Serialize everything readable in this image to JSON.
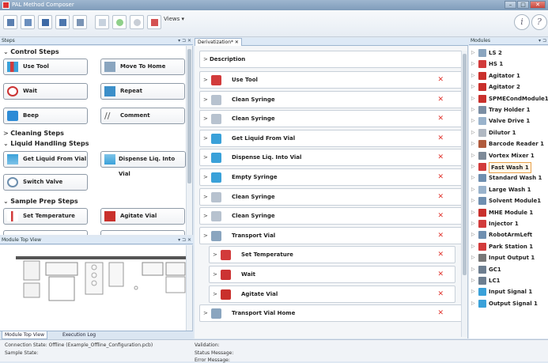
{
  "app": {
    "title": "PAL Method Composer"
  },
  "toolbar": {
    "views_label": "Views ▾",
    "help_label": "i",
    "help2_label": "?"
  },
  "steps_pane": {
    "title": "Steps",
    "sections": {
      "control": "Control Steps",
      "cleaning": "Cleaning Steps",
      "liquid": "Liquid Handling Steps",
      "sample_prep": "Sample Prep Steps"
    },
    "buttons": {
      "use_tool": "Use Tool",
      "move_home": "Move To Home",
      "wait": "Wait",
      "repeat": "Repeat",
      "beep": "Beep",
      "comment": "Comment",
      "get_liquid": "Get Liquid From Vial",
      "dispense": "Dispense Liq. Into Vial",
      "switch_valve": "Switch Valve",
      "set_temp": "Set Temperature",
      "agitate": "Agitate Vial"
    }
  },
  "module_view": {
    "title": "Module Top View"
  },
  "bottom_tabs": {
    "module_top_view": "Module Top View",
    "execution_log": "Execution Log"
  },
  "derivation": {
    "tab_label": "Derivatization* ✕",
    "description": "Description",
    "rows": [
      "Use Tool",
      "Clean Syringe",
      "Clean Syringe",
      "Get Liquid From Vial",
      "Dispense Liq. Into Vial",
      "Empty Syringe",
      "Clean Syringe",
      "Clean Syringe",
      "Transport Vial",
      "Set Temperature",
      "Wait",
      "Agitate Vial",
      "Transport Vial Home"
    ]
  },
  "modules_pane": {
    "title": "Modules",
    "items": [
      "LS 2",
      "HS 1",
      "Agitator 1",
      "Agitator 2",
      "SPMECondModule1",
      "Tray Holder 1",
      "Valve Drive 1",
      "Dilutor 1",
      "Barcode Reader 1",
      "Vortex Mixer 1",
      "Fast Wash 1",
      "Standard Wash 1",
      "Large Wash 1",
      "Solvent Module1",
      "MHE Module 1",
      "Injector 1",
      "RobotArmLeft",
      "Park Station 1",
      "Input Output 1",
      "GC1",
      "LC1",
      "Input Signal 1",
      "Output Signal 1"
    ]
  },
  "status": {
    "connection": "Connection State:   Offline (Example_Offline_Configuration.pcb)",
    "sample": "Sample State:",
    "validation": "Validation:",
    "status_message": "Status Message:",
    "error_message": "Error Message:"
  }
}
